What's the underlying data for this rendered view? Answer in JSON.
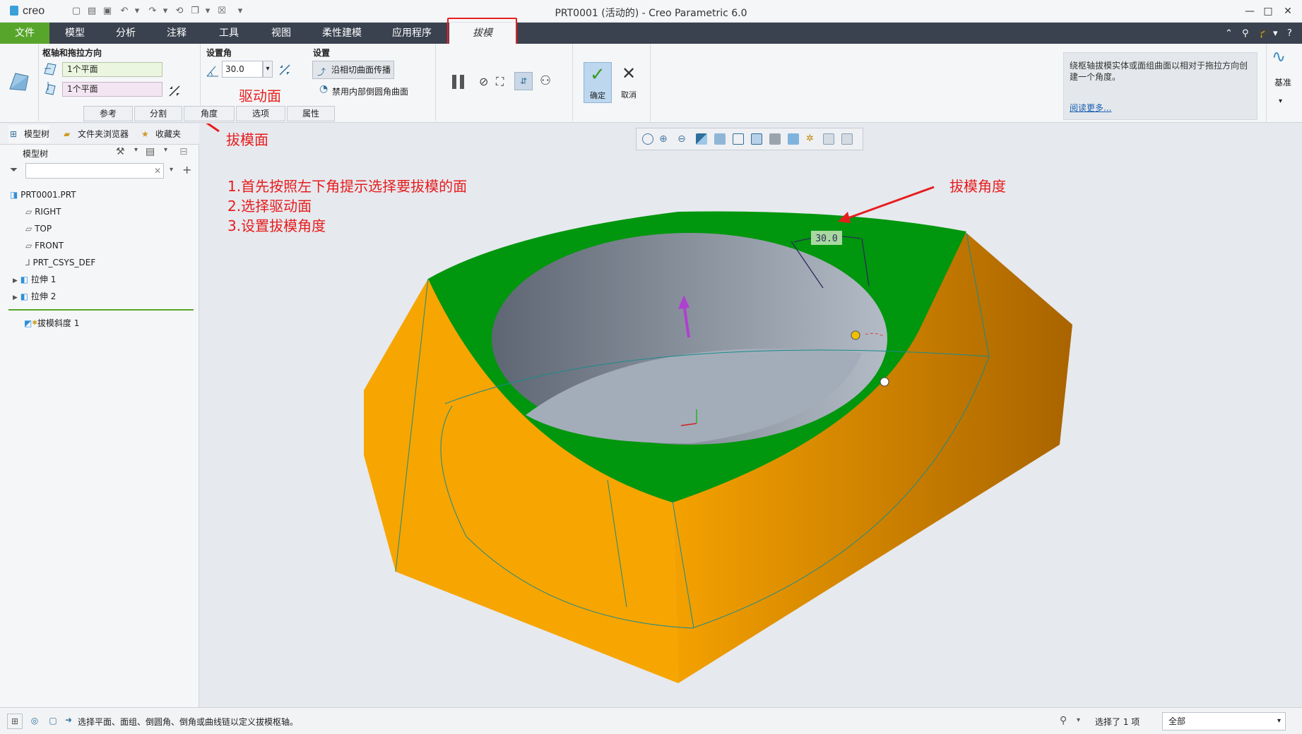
{
  "app": {
    "brand": "creo",
    "window_title": "PRT0001 (活动的) - Creo Parametric 6.0"
  },
  "ribbon": {
    "file_tab": "文件",
    "tabs": [
      "模型",
      "分析",
      "注释",
      "工具",
      "视图",
      "柔性建模",
      "应用程序"
    ],
    "active_tab": "拔模"
  },
  "dashboard": {
    "pivot_group_title": "枢轴和拖拉方向",
    "pivot_collector_1": "1个平面",
    "pivot_collector_2": "1个平面",
    "angle_group_title": "设置角",
    "angle_value": "30.0",
    "settings_group_title": "设置",
    "propagate_button": "沿相切曲面传播",
    "exclude_round_label": "禁用内部倒圆角曲面",
    "subtabs": [
      "参考",
      "分割",
      "角度",
      "选项",
      "属性"
    ],
    "ok_label": "确定",
    "cancel_label": "取消",
    "help_text": "绕枢轴拔模实体或面组曲面以相对于拖拉方向创建一个角度。",
    "help_link": "阅读更多...",
    "datum_label": "基准"
  },
  "left_panel": {
    "tabs": [
      "模型树",
      "文件夹浏览器",
      "收藏夹"
    ],
    "tree_header": "模型树",
    "items": [
      "PRT0001.PRT",
      "RIGHT",
      "TOP",
      "FRONT",
      "PRT_CSYS_DEF",
      "拉伸 1",
      "拉伸 2",
      "拔模斜度 1"
    ]
  },
  "annotations": {
    "drive_face": "驱动面",
    "draft_face": "拔模面",
    "draft_angle": "拔模角度",
    "step1": "1.首先按照左下角提示选择要拔模的面",
    "step2": "2.选择驱动面",
    "step3": "3.设置拔模角度",
    "dim_label": "30.0"
  },
  "status": {
    "message": "选择平面、面组、倒圆角、倒角或曲线链以定义拔模枢轴。",
    "selection_count": "选择了 1 项",
    "filter_value": "全部"
  },
  "colors": {
    "file_tab": "#57a62b",
    "green_face": "#00960e",
    "orange_body": "#f5a000",
    "annotation_red": "#e61d1d"
  }
}
